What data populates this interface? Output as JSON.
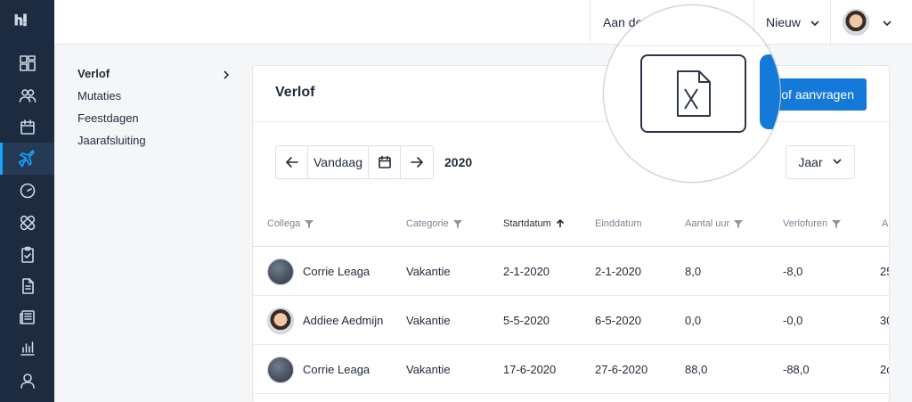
{
  "app": {
    "logo_text": "h!"
  },
  "topbar": {
    "aan_label": "Aan de",
    "new_label": "Nieuw"
  },
  "rail_icons": [
    "dashboard-icon",
    "people-icon",
    "calendar-icon",
    "plane-icon",
    "clock-icon",
    "bandage-icon",
    "clipboard-icon",
    "document-icon",
    "newspaper-icon",
    "chart-icon",
    "user-icon"
  ],
  "subnav": {
    "items": [
      "Verlof",
      "Mutaties",
      "Feestdagen",
      "Jaarafsluiting"
    ]
  },
  "card": {
    "title": "Verlof",
    "primary_button": "lof aanvragen",
    "export_icon": "excel-file-icon"
  },
  "date_control": {
    "today_label": "Vandaag",
    "year": "2020",
    "period_select": "Jaar"
  },
  "table": {
    "columns": [
      "Collega",
      "Categorie",
      "Startdatum",
      "Einddatum",
      "Aantal uur",
      "Verlofuren",
      "A"
    ],
    "rows": [
      {
        "collega": "Corrie Leaga",
        "categorie": "Vakantie",
        "start": "2-1-2020",
        "eind": "2-1-2020",
        "uren": "8,0",
        "verlof": "-8,0",
        "extra": "25"
      },
      {
        "collega": "Addiee Aedmijn",
        "categorie": "Vakantie",
        "start": "5-5-2020",
        "eind": "6-5-2020",
        "uren": "0,0",
        "verlof": "-0,0",
        "extra": "30"
      },
      {
        "collega": "Corrie Leaga",
        "categorie": "Vakantie",
        "start": "17-6-2020",
        "eind": "27-6-2020",
        "uren": "88,0",
        "verlof": "-88,0",
        "extra": "2c"
      }
    ]
  },
  "colors": {
    "rail": "#1c2b40",
    "accent": "#1479d9",
    "active_indicator": "#1aa3ff"
  }
}
